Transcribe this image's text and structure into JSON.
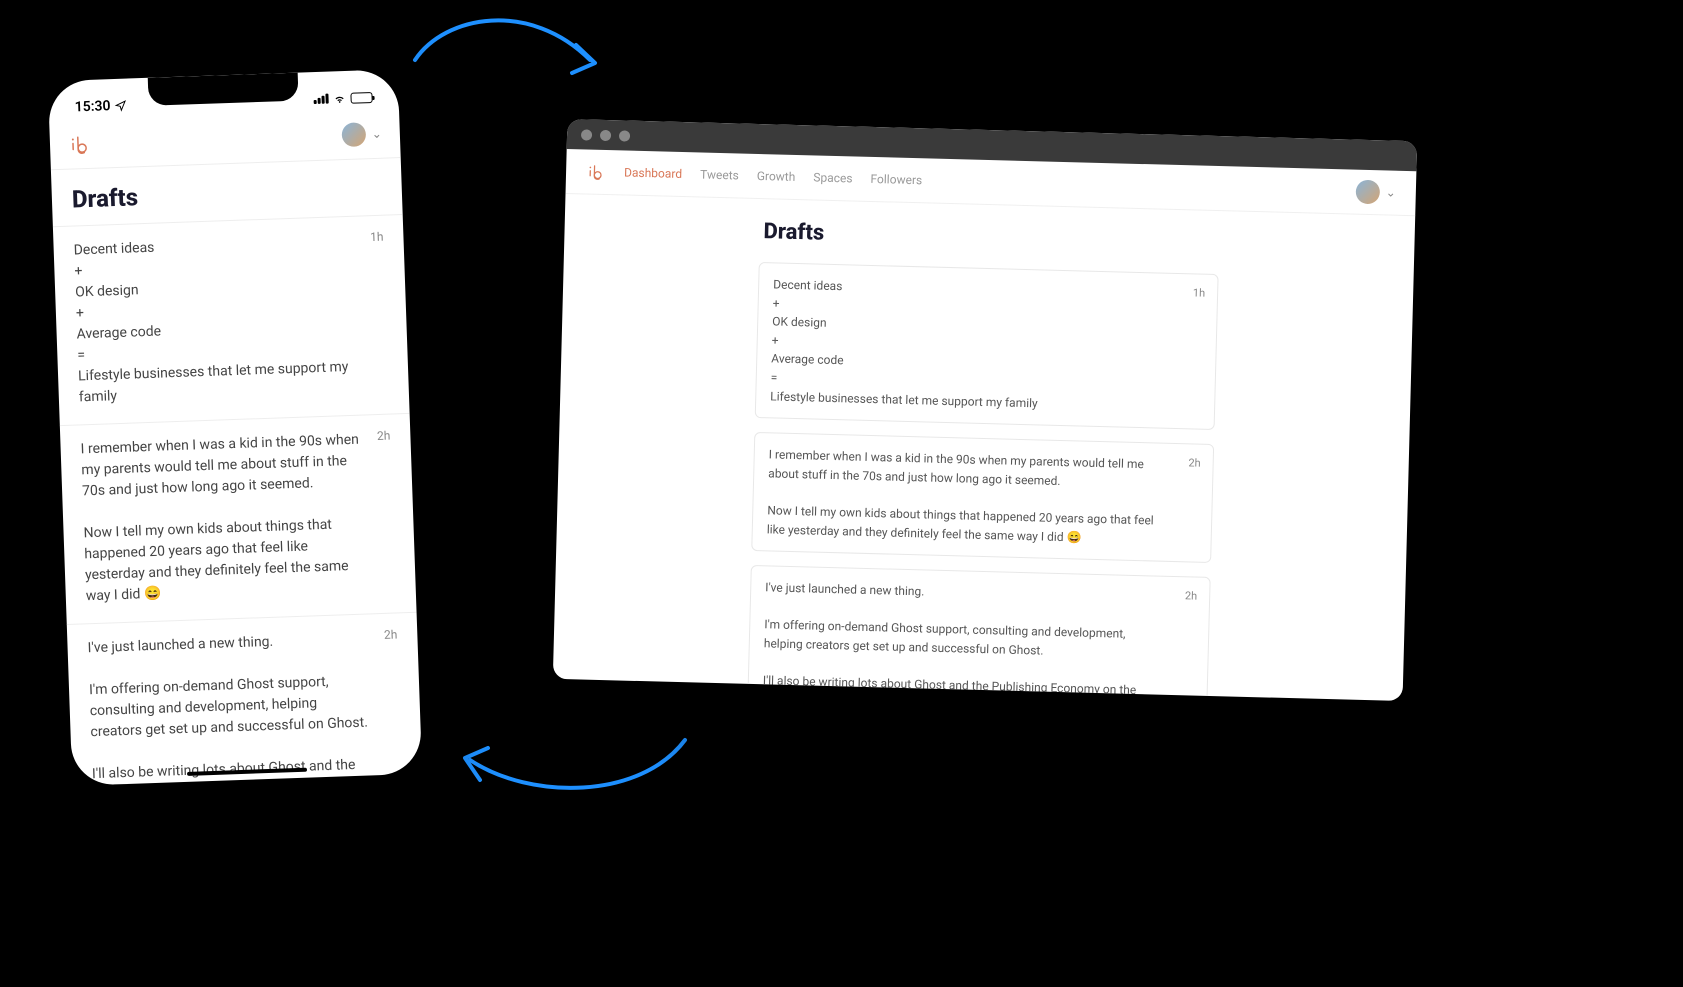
{
  "phone": {
    "status": {
      "time": "15:30"
    },
    "logo": "ilo",
    "title": "Drafts"
  },
  "desktop": {
    "logo": "ilo",
    "nav": [
      "Dashboard",
      "Tweets",
      "Growth",
      "Spaces",
      "Followers"
    ],
    "title": "Drafts"
  },
  "drafts": [
    {
      "time": "1h",
      "content": "Decent ideas\n+\nOK design\n+\nAverage code\n=\nLifestyle businesses that let me support my family"
    },
    {
      "time": "2h",
      "content": "I remember when I was a kid in the 90s when my parents would tell me about stuff in the 70s and just how long ago it seemed.\n\nNow I tell my own kids about things that happened 20 years ago that feel like yesterday and they definitely feel the same way I did 😄"
    },
    {
      "time": "2h",
      "content": "I've just launched a new thing.\n\nI'm offering on-demand Ghost support, consulting and development, helping creators get set up and successful on Ghost.\n\nI'll also be writing lots about Ghost and the Publishing Economy on the blog.\n\n→ codelet.dev"
    }
  ]
}
